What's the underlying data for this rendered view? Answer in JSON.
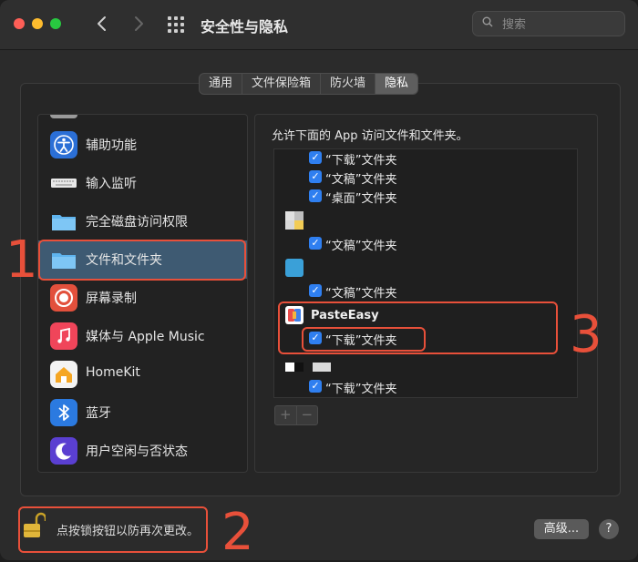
{
  "window": {
    "title": "安全性与隐私"
  },
  "search": {
    "placeholder": "搜索"
  },
  "tabs": [
    {
      "label": "通用",
      "active": false
    },
    {
      "label": "文件保险箱",
      "active": false
    },
    {
      "label": "防火墙",
      "active": false
    },
    {
      "label": "隐私",
      "active": true
    }
  ],
  "sidebar": {
    "items": [
      {
        "label": "辅助功能",
        "icon": "accessibility-icon"
      },
      {
        "label": "输入监听",
        "icon": "keyboard-icon"
      },
      {
        "label": "完全磁盘访问权限",
        "icon": "folder-icon"
      },
      {
        "label": "文件和文件夹",
        "icon": "folder-icon",
        "selected": true
      },
      {
        "label": "屏幕录制",
        "icon": "screen-record-icon"
      },
      {
        "label": "媒体与 Apple Music",
        "icon": "music-icon"
      },
      {
        "label": "HomeKit",
        "icon": "home-icon"
      },
      {
        "label": "蓝牙",
        "icon": "bluetooth-icon"
      },
      {
        "label": "用户空闲与否状态",
        "icon": "moon-icon"
      }
    ]
  },
  "right": {
    "heading": "允许下面的 App 访问文件和文件夹。",
    "rows": [
      {
        "label": "“下载”文件夹",
        "checked": true
      },
      {
        "label": "“文稿”文件夹",
        "checked": true
      },
      {
        "label": "“桌面”文件夹",
        "checked": true
      },
      {
        "label": "“文稿”文件夹",
        "checked": true
      },
      {
        "label": "“文稿”文件夹",
        "checked": true
      },
      {
        "label": "“下载”文件夹",
        "checked": true
      },
      {
        "label": "“下载”文件夹",
        "checked": true
      }
    ],
    "apps": [
      {
        "name": "PasteEasy"
      }
    ],
    "add_label": "+",
    "remove_label": "−"
  },
  "footer": {
    "lock_text": "点按锁按钮以防再次更改。",
    "advanced_label": "高级...",
    "help_label": "?"
  },
  "annotations": [
    "1",
    "2",
    "3"
  ],
  "colors": {
    "accent": "#2f7ff0",
    "selection": "#3e5a72",
    "annotation": "#e8503a"
  }
}
